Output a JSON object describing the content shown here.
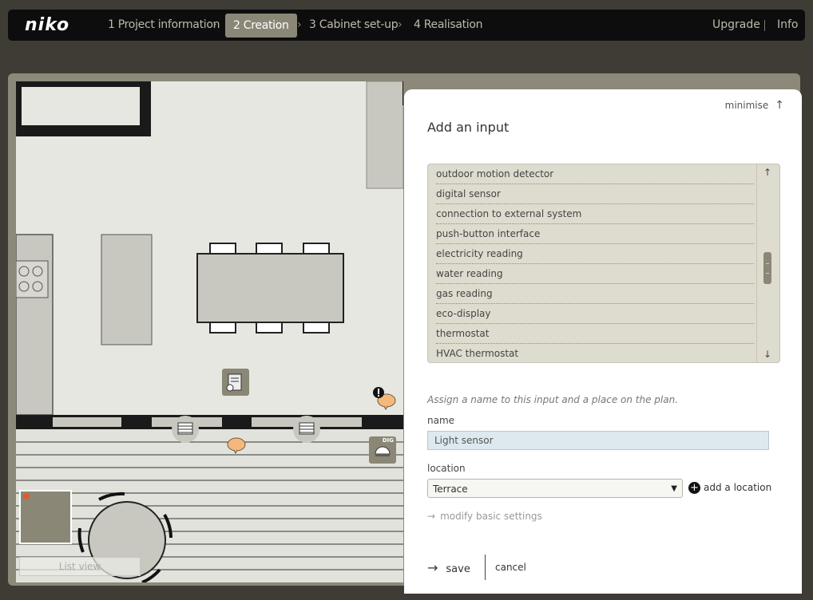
{
  "header": {
    "logo": "niko",
    "steps": [
      {
        "label": "1 Project information",
        "active": false
      },
      {
        "label": "2 Creation",
        "active": true
      },
      {
        "label": "3 Cabinet set-up",
        "active": false
      },
      {
        "label": "4 Realisation",
        "active": false
      }
    ],
    "upgrade": "Upgrade",
    "info": "Info"
  },
  "plan": {
    "list_view_label": "List view",
    "sensor_tag": "DIG"
  },
  "panel": {
    "minimise": "minimise",
    "title": "Add an input",
    "input_options": [
      "outdoor motion detector",
      "digital sensor",
      "connection to external system",
      "push-button interface",
      "electricity reading",
      "water reading",
      "gas reading",
      "eco-display",
      "thermostat",
      "HVAC thermostat"
    ],
    "hint": "Assign a name to this input and a place on the plan.",
    "name_label": "name",
    "name_value": "Light sensor",
    "location_label": "location",
    "location_value": "Terrace",
    "add_location": "add a location",
    "modify_settings": "modify basic settings",
    "save": "save",
    "cancel": "cancel"
  },
  "colors": {
    "accent": "#8a8777",
    "topbar": "#0d0d0d",
    "list_bg": "#dedbcf",
    "bubble": "#f5b77a"
  }
}
